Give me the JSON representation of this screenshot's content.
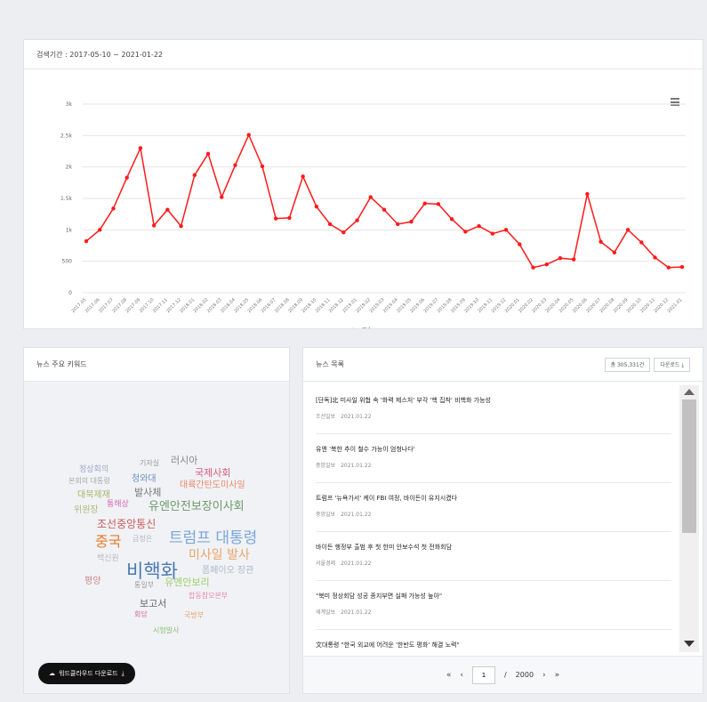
{
  "chart_panel": {
    "period_label": "검색기간 : 2017-05-10 ~ 2021-01-22",
    "legend_label": "건수",
    "menu_icon": "hamburger-menu-icon"
  },
  "chart_data": {
    "type": "line",
    "ylim": [
      0,
      3000
    ],
    "y_ticks": [
      "0",
      "500",
      "1k",
      "1.5k",
      "2k",
      "2.5k",
      "3k"
    ],
    "y_tick_values": [
      0,
      500,
      1000,
      1500,
      2000,
      2500,
      3000
    ],
    "categories": [
      "2017.05",
      "2017.06",
      "2017.07",
      "2017.08",
      "2017.09",
      "2017.10",
      "2017.11",
      "2017.12",
      "2018.01",
      "2018.02",
      "2018.03",
      "2018.04",
      "2018.05",
      "2018.06",
      "2018.07",
      "2018.08",
      "2018.09",
      "2018.10",
      "2018.11",
      "2018.12",
      "2019.01",
      "2019.02",
      "2019.03",
      "2019.04",
      "2019.05",
      "2019.06",
      "2019.07",
      "2019.08",
      "2019.09",
      "2019.10",
      "2019.11",
      "2019.12",
      "2020.01",
      "2020.02",
      "2020.03",
      "2020.04",
      "2020.05",
      "2020.06",
      "2020.07",
      "2020.08",
      "2020.09",
      "2020.10",
      "2020.11",
      "2020.12",
      "2021.01"
    ],
    "x_tick_labels": [
      "2017.05",
      "2017.06",
      "2017.07",
      "2017.08",
      "2017.09",
      "2017.10",
      "2017.11",
      "2017.12",
      "2018.01",
      "2018.02",
      "2018.03",
      "2018.04",
      "2018.05",
      "2018.06",
      "2018.07",
      "2018.08",
      "2018.09",
      "2018.10",
      "2018.11",
      "2018.12",
      "2019.01",
      "2019.02",
      "2019.03",
      "2019.04",
      "2019.05",
      "2019.06",
      "2019.07",
      "2019.08",
      "2019.09",
      "2019.10",
      "2019.11",
      "2019.12",
      "2020.01",
      "2020.02",
      "2020.03",
      "2020.04",
      "2020.05",
      "2020.06",
      "2020.07",
      "2020.08",
      "2020.09",
      "2020.10",
      "2020.11",
      "2020.12",
      "2021.01"
    ],
    "series": [
      {
        "name": "건수",
        "color": "#ff1a1a",
        "values": [
          820,
          1000,
          1340,
          1830,
          2300,
          1070,
          1320,
          1060,
          1870,
          2210,
          1520,
          2030,
          2510,
          2010,
          1180,
          1190,
          1850,
          1370,
          1090,
          960,
          1150,
          1520,
          1320,
          1090,
          1130,
          1420,
          1410,
          1170,
          970,
          1060,
          940,
          1000,
          770,
          400,
          450,
          550,
          530,
          1570,
          810,
          640,
          1000,
          800,
          560,
          400,
          410
        ]
      }
    ],
    "grid": true,
    "legend_position": "bottom-center"
  },
  "keyword_panel": {
    "title": "뉴스 주요 키워드",
    "download_label": "워드클라우드 다운로드",
    "download_icon": "download-icon",
    "words": [
      {
        "text": "러시아",
        "color": "#888888",
        "size": 11
      },
      {
        "text": "기자실",
        "color": "#999999",
        "size": 8
      },
      {
        "text": "국제사회",
        "color": "#d25a7a",
        "size": 11
      },
      {
        "text": "정상회의",
        "color": "#a0a8c8",
        "size": 9
      },
      {
        "text": "청와대",
        "color": "#6b8fc9",
        "size": 10
      },
      {
        "text": "본회의 대통령",
        "color": "#aaaaaa",
        "size": 8
      },
      {
        "text": "대륙간탄도미사일",
        "color": "#e8896a",
        "size": 10
      },
      {
        "text": "대북제재",
        "color": "#a5b86a",
        "size": 10
      },
      {
        "text": "발사체",
        "color": "#777777",
        "size": 11
      },
      {
        "text": "통해상",
        "color": "#d66ab0",
        "size": 9
      },
      {
        "text": "위원장",
        "color": "#b5b87a",
        "size": 10
      },
      {
        "text": "유엔안전보장이사회",
        "color": "#6a9a6a",
        "size": 13
      },
      {
        "text": "조선중앙통신",
        "color": "#c75a5a",
        "size": 12
      },
      {
        "text": "트럼프 대통령",
        "color": "#7aa6d9",
        "size": 17
      },
      {
        "text": "중국",
        "color": "#e87a2a",
        "size": 16
      },
      {
        "text": "금정은",
        "color": "#aab8c8",
        "size": 8
      },
      {
        "text": "미사일 발사",
        "color": "#e8a66a",
        "size": 14
      },
      {
        "text": "백신원",
        "color": "#bbbbbb",
        "size": 9
      },
      {
        "text": "비핵화",
        "color": "#4a7ab5",
        "size": 21
      },
      {
        "text": "폼페이오 장관",
        "color": "#aabbcc",
        "size": 10
      },
      {
        "text": "평양",
        "color": "#c88a8a",
        "size": 10
      },
      {
        "text": "통일부",
        "color": "#999999",
        "size": 8
      },
      {
        "text": "유엔안보리",
        "color": "#9ad06a",
        "size": 11
      },
      {
        "text": "합동참모본부",
        "color": "#e88aaa",
        "size": 8
      },
      {
        "text": "보고서",
        "color": "#666666",
        "size": 11
      },
      {
        "text": "회담",
        "color": "#d66a9a",
        "size": 8
      },
      {
        "text": "국방부",
        "color": "#e8a06a",
        "size": 8
      },
      {
        "text": "시험발사",
        "color": "#8ac07a",
        "size": 8
      }
    ]
  },
  "news_panel": {
    "title": "뉴스 목록",
    "count_button": "총 305,331건",
    "download_button": "다운로드",
    "items": [
      {
        "title": "[단독]北 미사일 위협 속 '화력 제스처' 부각 '핵 집착' 비핵화 가능성",
        "source": "조선일보",
        "date": "2021.01.22"
      },
      {
        "title": "유엔 '북한 추이 철수 가능이 엄청나다'",
        "source": "중앙일보",
        "date": "2021.01.22"
      },
      {
        "title": "트럼프 '뉴욕가서' 케이 FBI 여정, 바이든이 유지시켰다",
        "source": "중앙일보",
        "date": "2021.01.22"
      },
      {
        "title": "바이든 행정부 출범 후 첫 한미 안보수석 첫 전화회담",
        "source": "서울경제",
        "date": "2021.01.22"
      },
      {
        "title": "\"북미 정상회담 성공 종지부면 실패 가능성 높아\"",
        "source": "세계일보",
        "date": "2021.01.22"
      },
      {
        "title": "文대통령 \"한국 외교에 어려운 '한반도 평화' 해결 노력\"",
        "source": "중앙일보",
        "date": "2021.01.22"
      }
    ],
    "pagination": {
      "current_page": "1",
      "separator": "/",
      "total_pages": "2000",
      "first": "«",
      "prev": "‹",
      "next": "›",
      "last": "»"
    }
  }
}
